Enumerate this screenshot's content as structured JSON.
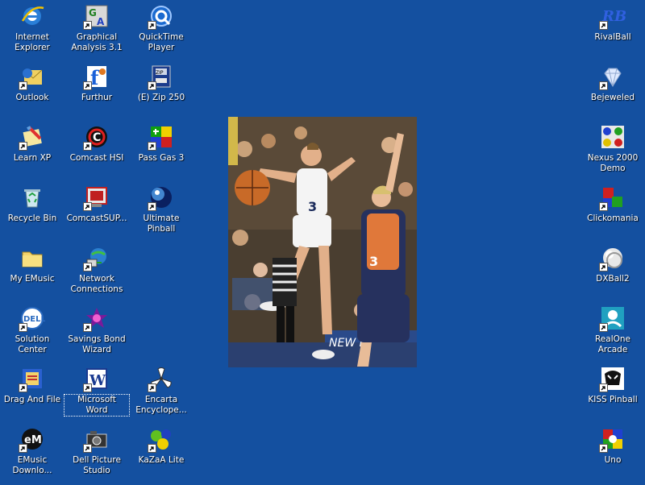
{
  "desktop": {
    "background": "#1450a0",
    "icons": [
      {
        "label": "Internet\nExplorer",
        "icon": "internet-explorer-icon",
        "shortcut": false
      },
      {
        "label": "Graphical\nAnalysis 3.1",
        "icon": "graphical-analysis-icon",
        "shortcut": true
      },
      {
        "label": "QuickTime\nPlayer",
        "icon": "quicktime-icon",
        "shortcut": true
      },
      {
        "label": "Outlook",
        "icon": "outlook-icon",
        "shortcut": true
      },
      {
        "label": "Furthur",
        "icon": "furthur-icon",
        "shortcut": true
      },
      {
        "label": "(E) Zip 250",
        "icon": "zip-drive-icon",
        "shortcut": true
      },
      {
        "label": "Learn XP",
        "icon": "learn-xp-icon",
        "shortcut": true
      },
      {
        "label": "Comcast HSI",
        "icon": "comcast-hsi-icon",
        "shortcut": true
      },
      {
        "label": "Pass Gas 3",
        "icon": "pass-gas-icon",
        "shortcut": true
      },
      {
        "label": "Recycle Bin",
        "icon": "recycle-bin-icon",
        "shortcut": false
      },
      {
        "label": "ComcastSUP...",
        "icon": "comcast-support-icon",
        "shortcut": true
      },
      {
        "label": "Ultimate Pinball",
        "icon": "pinball-icon",
        "shortcut": true
      },
      {
        "label": "My EMusic",
        "icon": "folder-icon",
        "shortcut": false
      },
      {
        "label": "Network\nConnections",
        "icon": "network-icon",
        "shortcut": true
      },
      {
        "label": "Solution Center",
        "icon": "dell-icon",
        "shortcut": true
      },
      {
        "label": "Savings Bond\nWizard",
        "icon": "savings-bond-icon",
        "shortcut": true
      },
      {
        "label": "Drag And File",
        "icon": "drag-and-file-icon",
        "shortcut": true
      },
      {
        "label": "Microsoft Word",
        "icon": "word-icon",
        "shortcut": true,
        "focused": true
      },
      {
        "label": "Encarta\nEncyclope...",
        "icon": "encarta-icon",
        "shortcut": true
      },
      {
        "label": "EMusic\nDownlo...",
        "icon": "emusic-icon",
        "shortcut": true
      },
      {
        "label": "Dell Picture\nStudio",
        "icon": "camera-icon",
        "shortcut": true
      },
      {
        "label": "KaZaA Lite",
        "icon": "kazaa-icon",
        "shortcut": true
      },
      {
        "label": "RivalBall",
        "icon": "rivalball-icon",
        "shortcut": true
      },
      {
        "label": "Bejeweled",
        "icon": "diamond-icon",
        "shortcut": true
      },
      {
        "label": "Nexus 2000\nDemo",
        "icon": "nexus-icon",
        "shortcut": false
      },
      {
        "label": "Clickomania",
        "icon": "clickomania-icon",
        "shortcut": true
      },
      {
        "label": "DXBall2",
        "icon": "dxball-icon",
        "shortcut": true
      },
      {
        "label": "RealOne\nArcade",
        "icon": "realone-icon",
        "shortcut": true
      },
      {
        "label": "KISS Pinball",
        "icon": "kiss-icon",
        "shortcut": true
      },
      {
        "label": "Uno",
        "icon": "uno-icon",
        "shortcut": true
      }
    ],
    "wallpaper": {
      "icon": "basketball-photo",
      "jersey_left": "3",
      "jersey_right": "3"
    }
  }
}
